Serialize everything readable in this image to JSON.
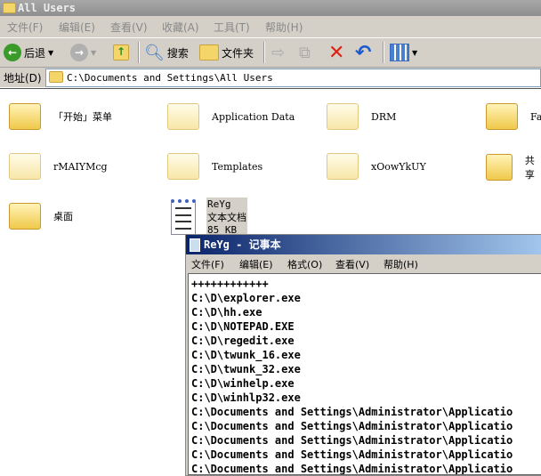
{
  "window": {
    "title": "All Users"
  },
  "menu": [
    "文件(F)",
    "编辑(E)",
    "查看(V)",
    "收藏(A)",
    "工具(T)",
    "帮助(H)"
  ],
  "toolbar": {
    "back": "后退",
    "search": "搜索",
    "folders": "文件夹"
  },
  "address": {
    "label": "地址(D)",
    "value": "C:\\Documents and Settings\\All Users"
  },
  "items": [
    {
      "name": "「开始」菜单"
    },
    {
      "name": "Application Data"
    },
    {
      "name": "DRM"
    },
    {
      "name": "Fav"
    },
    {
      "name": "rMAIYMcg"
    },
    {
      "name": "Templates"
    },
    {
      "name": "xOowYkUY"
    },
    {
      "name": "共享"
    },
    {
      "name": "桌面"
    }
  ],
  "file": {
    "name": "ReYg",
    "type": "文本文档",
    "size": "85 KB"
  },
  "notepad": {
    "title": "ReYg - 记事本",
    "menu": [
      "文件(F)",
      "编辑(E)",
      "格式(O)",
      "查看(V)",
      "帮助(H)"
    ],
    "lines": [
      "++++++++++++",
      "C:\\D\\explorer.exe",
      "C:\\D\\hh.exe",
      "C:\\D\\NOTEPAD.EXE",
      "C:\\D\\regedit.exe",
      "C:\\D\\twunk_16.exe",
      "C:\\D\\twunk_32.exe",
      "C:\\D\\winhelp.exe",
      "C:\\D\\winhlp32.exe",
      "C:\\Documents and Settings\\Administrator\\Applicatio",
      "C:\\Documents and Settings\\Administrator\\Applicatio",
      "C:\\Documents and Settings\\Administrator\\Applicatio",
      "C:\\Documents and Settings\\Administrator\\Applicatio",
      "C:\\Documents and Settings\\Administrator\\Applicatio"
    ]
  }
}
